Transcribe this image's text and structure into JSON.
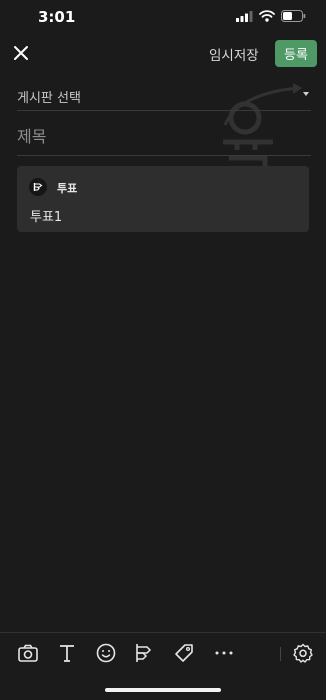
{
  "status_bar": {
    "time": "3:01"
  },
  "nav": {
    "draft_label": "임시저장",
    "register_label": "등록"
  },
  "board_select": {
    "label": "게시판 선택"
  },
  "title_field": {
    "placeholder": "제목"
  },
  "poll_card": {
    "header": "투표",
    "text": "투표1"
  },
  "colors": {
    "background": "#1b1b1b",
    "accent": "#4e9966",
    "card": "#2e2e2e"
  },
  "toolbar": {
    "icons": [
      "camera-icon",
      "text-icon",
      "emoji-icon",
      "poll-icon",
      "tag-icon",
      "more-icon",
      "gear-icon"
    ]
  }
}
